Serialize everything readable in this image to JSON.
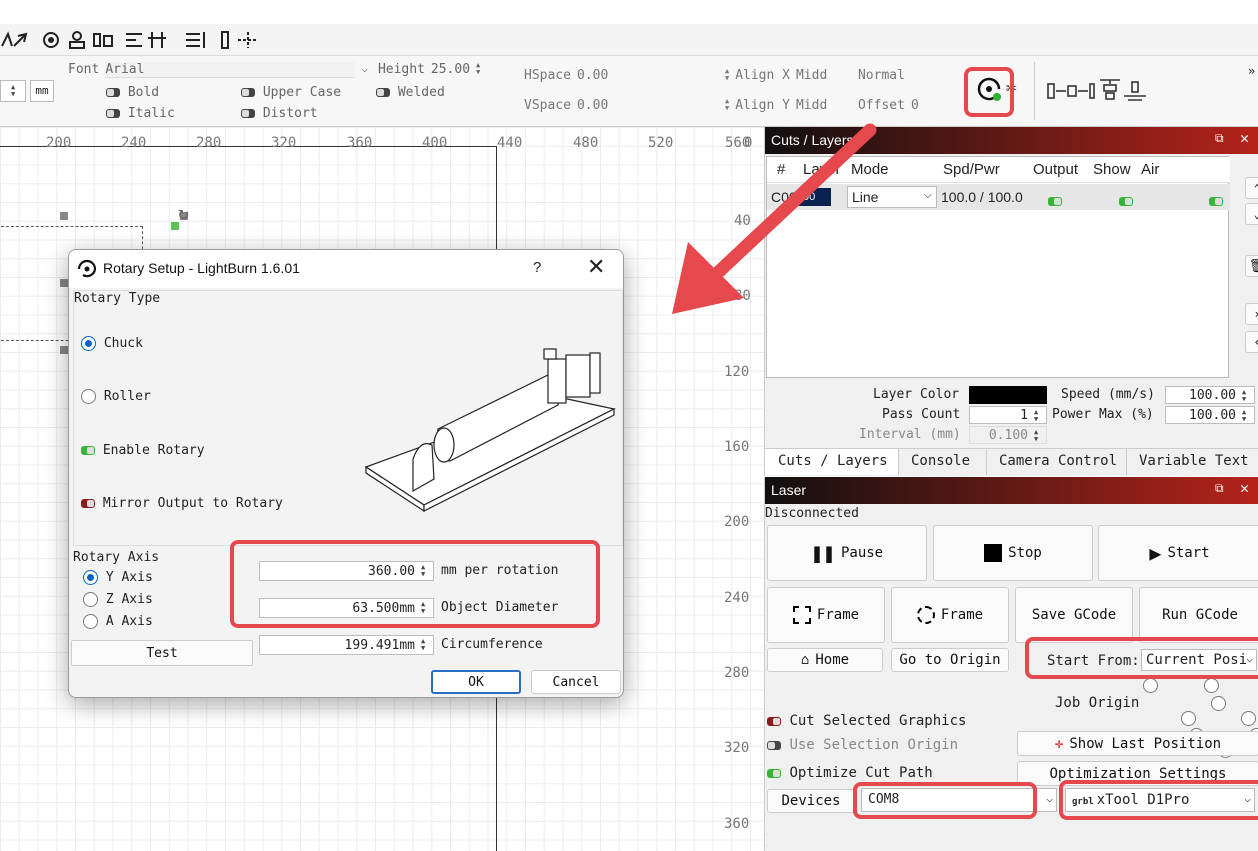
{
  "toolbar": {
    "mm_unit": "mm"
  },
  "text_options": {
    "font_label": "Font",
    "font_value": "Arial",
    "height_label": "Height",
    "height_value": "25.00",
    "hspace_label": "HSpace",
    "hspace_value": "0.00",
    "vspace_label": "VSpace",
    "vspace_value": "0.00",
    "align_x_label": "Align X",
    "align_x_value": "Midd",
    "align_y_label": "Align Y",
    "align_y_value": "Midd",
    "normal_value": "Normal",
    "offset_label": "Offset",
    "offset_value": "0",
    "bold": "Bold",
    "italic": "Italic",
    "upper_case": "Upper Case",
    "distort": "Distort",
    "welded": "Welded"
  },
  "ruler": {
    "top": [
      "200",
      "240",
      "280",
      "320",
      "360",
      "400",
      "440",
      "480",
      "520",
      "560"
    ],
    "left": [
      "0",
      "40",
      "80",
      "120",
      "160",
      "200",
      "240",
      "280",
      "320",
      "360"
    ]
  },
  "rotary_dialog": {
    "title": "Rotary Setup - LightBurn 1.6.01",
    "help": "?",
    "rotary_type_label": "Rotary Type",
    "chuck": "Chuck",
    "roller": "Roller",
    "enable_rotary": "Enable Rotary",
    "mirror_output": "Mirror Output to Rotary",
    "rotary_axis_label": "Rotary Axis",
    "y_axis": "Y Axis",
    "z_axis": "Z Axis",
    "a_axis": "A Axis",
    "test": "Test",
    "mm_per_rotation_value": "360.00",
    "mm_per_rotation_label": "mm per rotation",
    "object_diameter_value": "63.500mm",
    "object_diameter_label": "Object Diameter",
    "circumference_value": "199.491mm",
    "circumference_label": "Circumference",
    "ok": "OK",
    "cancel": "Cancel"
  },
  "cuts_panel": {
    "title": "Cuts / Layers",
    "headers": [
      "#",
      "Layer",
      "Mode",
      "Spd/Pwr",
      "Output",
      "Show",
      "Air"
    ],
    "row": {
      "num": "C00",
      "layer": "00",
      "mode": "Line",
      "spd_pwr": "100.0 / 100.0"
    },
    "layer_color_label": "Layer Color",
    "speed_label": "Speed (mm/s)",
    "speed_value": "100.00",
    "pass_count_label": "Pass Count",
    "pass_count_value": "1",
    "power_max_label": "Power Max (%)",
    "power_max_value": "100.00",
    "interval_label": "Interval (mm)",
    "interval_value": "0.100",
    "tabs": [
      "Cuts / Layers",
      "Console",
      "Camera Control",
      "Variable Text"
    ]
  },
  "laser_panel": {
    "title": "Laser",
    "status": "Disconnected",
    "pause": "Pause",
    "stop": "Stop",
    "start": "Start",
    "frame1": "Frame",
    "frame2": "Frame",
    "save_gcode": "Save GCode",
    "run_gcode": "Run GCode",
    "home": "Home",
    "go_to_origin": "Go to Origin",
    "start_from_label": "Start From:",
    "start_from_value": "Current Posi",
    "job_origin": "Job Origin",
    "cut_selected": "Cut Selected Graphics",
    "use_selection_origin": "Use Selection Origin",
    "optimize_cut_path": "Optimize Cut Path",
    "show_last_position": "Show Last Position",
    "optimization_settings": "Optimization Settings",
    "devices": "Devices",
    "port": "COM8",
    "device_badge": "grbl",
    "device": "xTool D1Pro"
  },
  "colors": {
    "highlight": "#e5484d",
    "accent_blue": "#0a64c8",
    "toggle_on": "#38b538",
    "panel_title_start": "#101010",
    "panel_title_end": "#b5231a"
  }
}
